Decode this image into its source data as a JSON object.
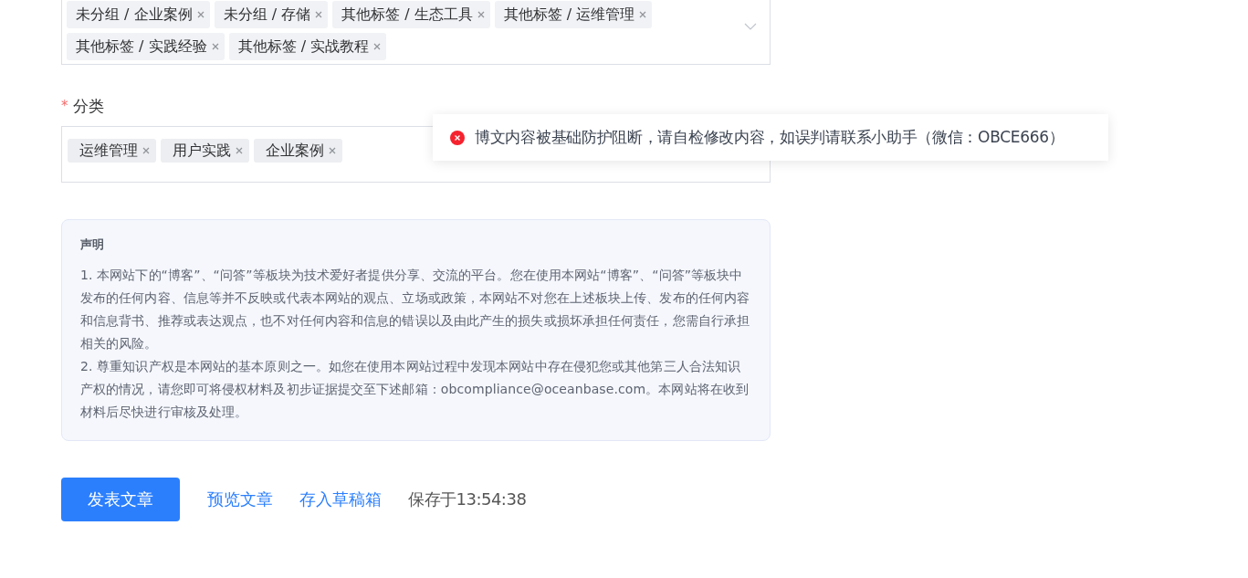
{
  "tags_field": {
    "tags": [
      {
        "label": "未分组 / 企业案例"
      },
      {
        "label": "未分组 / 存储"
      },
      {
        "label": "其他标签 / 生态工具"
      },
      {
        "label": "其他标签 / 运维管理"
      },
      {
        "label": "其他标签 / 实践经验"
      },
      {
        "label": "其他标签 / 实战教程"
      }
    ]
  },
  "category": {
    "label": "分类",
    "required_mark": "*",
    "tags": [
      {
        "label": "运维管理"
      },
      {
        "label": "用户实践"
      },
      {
        "label": "企业案例"
      }
    ]
  },
  "toast": {
    "kind": "error",
    "message": "博文内容被基础防护阻断，请自检修改内容，如误判请联系小助手（微信：OBCE666）"
  },
  "notice": {
    "title": "声明",
    "paragraphs": [
      "1. 本网站下的“博客”、“问答”等板块为技术爱好者提供分享、交流的平台。您在使用本网站“博客”、“问答”等板块中发布的任何内容、信息等并不反映或代表本网站的观点、立场或政策，本网站不对您在上述板块上传、发布的任何内容和信息背书、推荐或表达观点，也不对任何内容和信息的错误以及由此产生的损失或损坏承担任何责任，您需自行承担相关的风险。",
      "2. 尊重知识产权是本网站的基本原则之一。如您在使用本网站过程中发现本网站中存在侵犯您或其他第三人合法知识产权的情况，请您即可将侵权材料及初步证据提交至下述邮箱：obcompliance@oceanbase.com。本网站将在收到材料后尽快进行审核及处理。"
    ]
  },
  "actions": {
    "publish": "发表文章",
    "preview": "预览文章",
    "draft": "存入草稿箱",
    "saved": "保存于13:54:38"
  }
}
